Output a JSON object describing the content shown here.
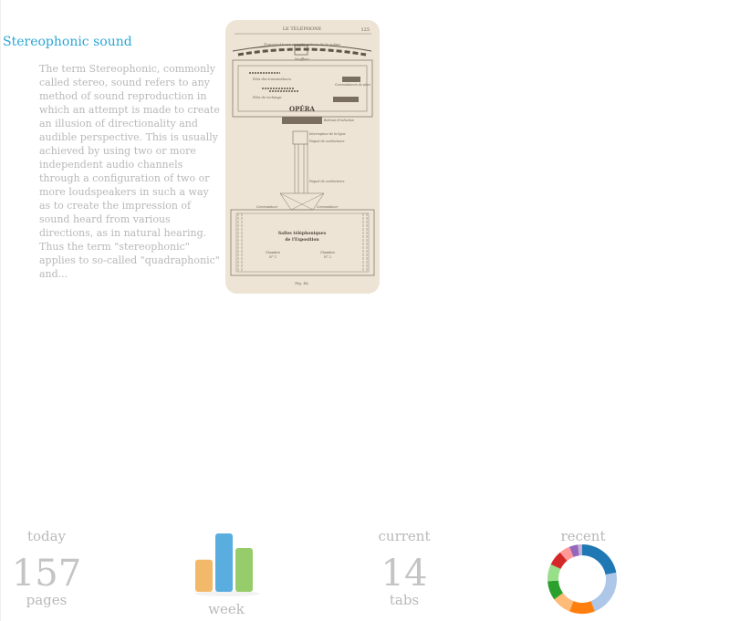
{
  "article": {
    "title": "Stereophonic sound",
    "excerpt": "The term Stereophonic, commonly called stereo, sound refers to any method of sound reproduction in which an attempt is made to create an illusion of directionality and audible perspective. This is usually achieved by using two or more independent audio channels through a configuration of two or more loudspeakers in such a way as to create the impression of sound heard from various directions, as in natural hearing. Thus the term \"stereophonic\" applies to so-called \"quadraphonic\" and...",
    "image": {
      "header_left": "LE TÉLÉPHONE",
      "header_right": "125",
      "top_caption": "Transmetteurs rangés autour de la scène",
      "label_souffleur": "Souffleur",
      "label_piles_transmission": "Piles des transmetteurs",
      "label_piles_rechange": "Piles de rechange",
      "label_commutateurs_piles": "Commutateurs de piles",
      "stage_label": "OPÉRA",
      "label_bobines": "Bobines d'induction",
      "label_interrupteur": "Interrupteur de la ligne",
      "label_paquet": "Paquet de conducteurs",
      "label_commutateur": "Commutateur",
      "label_salles_line1": "Salles téléphoniques",
      "label_salles_line2": "de l'Exposition",
      "label_chambre1": "Chambre",
      "label_chambre1_no": "N° 1",
      "label_chambre2": "Chambre",
      "label_chambre2_no": "N° 2",
      "fig_caption": "Fig. 48."
    }
  },
  "stats": {
    "today": {
      "label": "today",
      "value": "157",
      "unit": "pages"
    },
    "week": {
      "label": "week"
    },
    "current": {
      "label": "current",
      "value": "14",
      "unit": "tabs"
    },
    "recent": {
      "label": "recent"
    }
  },
  "week_chart": {
    "bars": [
      {
        "level": 0.55,
        "color": "#f3b96a"
      },
      {
        "level": 1.0,
        "color": "#5aaedf"
      },
      {
        "level": 0.75,
        "color": "#97cc6a"
      }
    ]
  },
  "recent_chart": {
    "segments": [
      {
        "value": 22,
        "color": "#1f77b4"
      },
      {
        "value": 22,
        "color": "#aec7e8"
      },
      {
        "value": 12,
        "color": "#ff7f0e"
      },
      {
        "value": 9,
        "color": "#ffbb78"
      },
      {
        "value": 9,
        "color": "#2ca02c"
      },
      {
        "value": 8,
        "color": "#98df8a"
      },
      {
        "value": 7,
        "color": "#d62728"
      },
      {
        "value": 5,
        "color": "#ff9896"
      },
      {
        "value": 4,
        "color": "#9467bd"
      },
      {
        "value": 2,
        "color": "#c5b0d5"
      }
    ]
  }
}
